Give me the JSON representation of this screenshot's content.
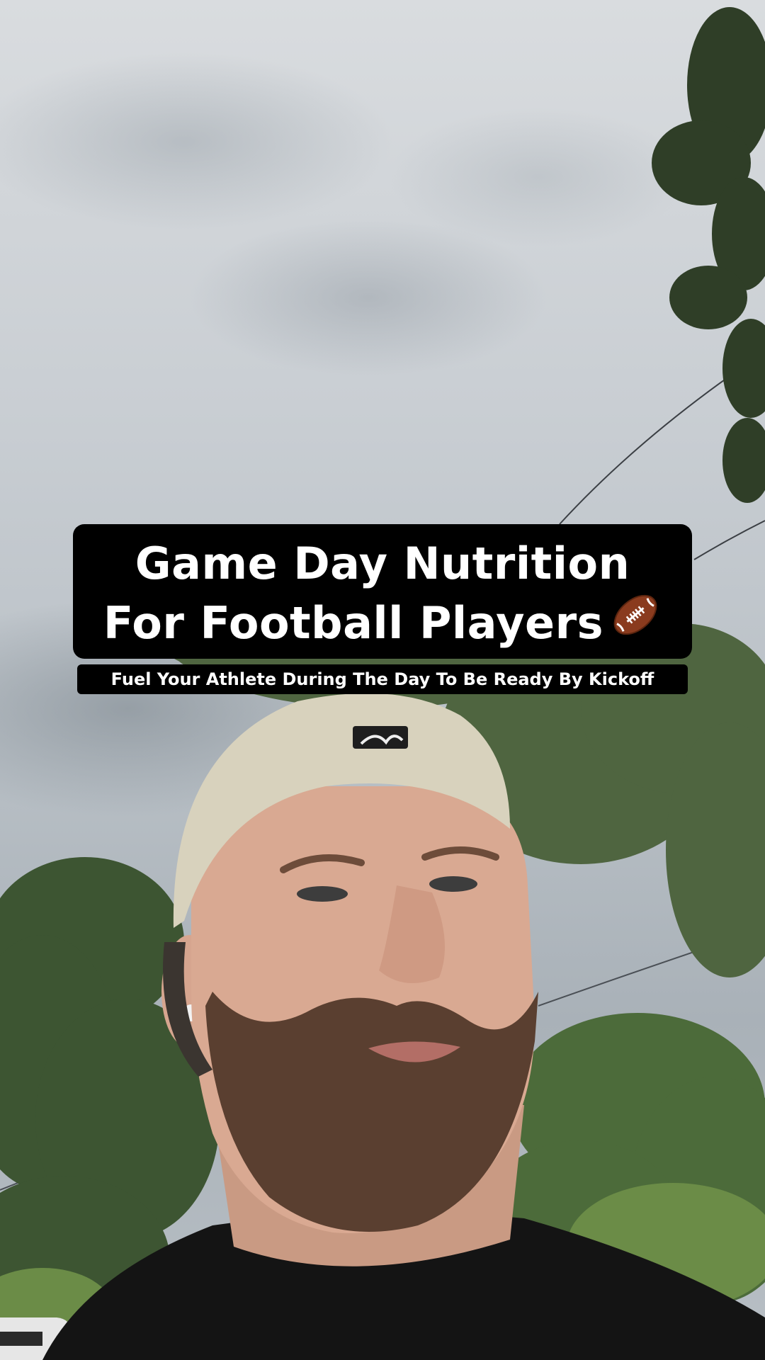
{
  "overlay": {
    "title_line_1": "Game Day Nutrition",
    "title_line_2": "For Football Players",
    "title_icon": "american-football-icon",
    "subtitle": "Fuel Your Athlete During The Day To Be Ready By Kickoff"
  },
  "colors": {
    "overlay_background": "#000000",
    "overlay_text": "#ffffff",
    "cap": "#d8d2bd",
    "shirt": "#141414",
    "foliage": "#3f5a2f"
  },
  "icons": {
    "cap_logo": "league-logo-icon"
  }
}
